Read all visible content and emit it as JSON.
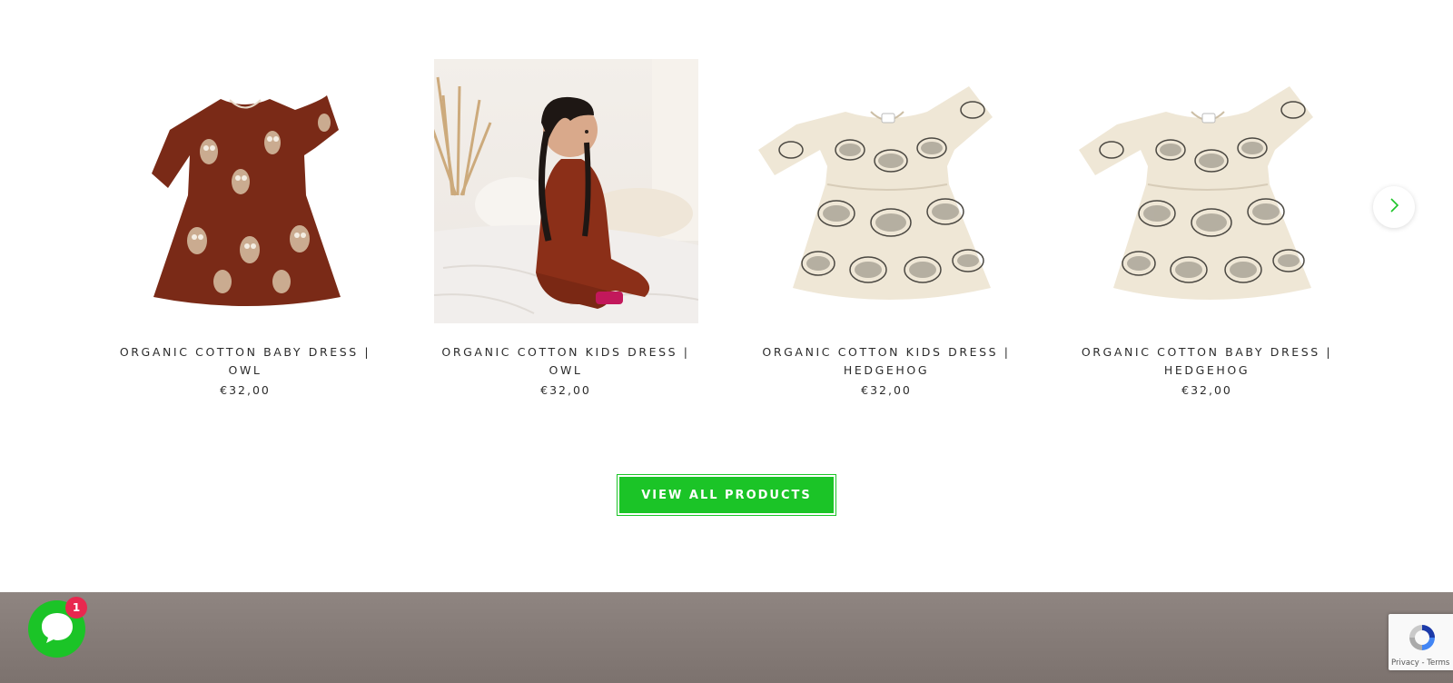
{
  "products": [
    {
      "title_line1": "ORGANIC COTTON BABY DRESS |",
      "title_line2": "OWL",
      "price": "€32,00",
      "image": "owl-dress-flat-image"
    },
    {
      "title_line1": "ORGANIC COTTON KIDS DRESS |",
      "title_line2": "OWL",
      "price": "€32,00",
      "image": "girl-in-owl-dress-photo"
    },
    {
      "title_line1": "ORGANIC COTTON KIDS DRESS |",
      "title_line2": "HEDGEHOG",
      "price": "€32,00",
      "image": "hedgehog-dress-flat-image"
    },
    {
      "title_line1": "ORGANIC COTTON BABY DRESS |",
      "title_line2": "HEDGEHOG",
      "price": "€32,00",
      "image": "hedgehog-dress-flat-image"
    }
  ],
  "carousel": {
    "next_icon": "chevron-right-icon"
  },
  "cta": {
    "view_all_label": "VIEW ALL PRODUCTS"
  },
  "chat": {
    "badge_count": "1",
    "icon": "chat-bubble-icon"
  },
  "recaptcha": {
    "links": "Privacy - Terms"
  },
  "colors": {
    "accent_green": "#1bc427",
    "owl_dress": "#7a2a17",
    "hedgehog_dress": "#efe7d6",
    "footer": "#857b77",
    "badge": "#e8284f"
  }
}
